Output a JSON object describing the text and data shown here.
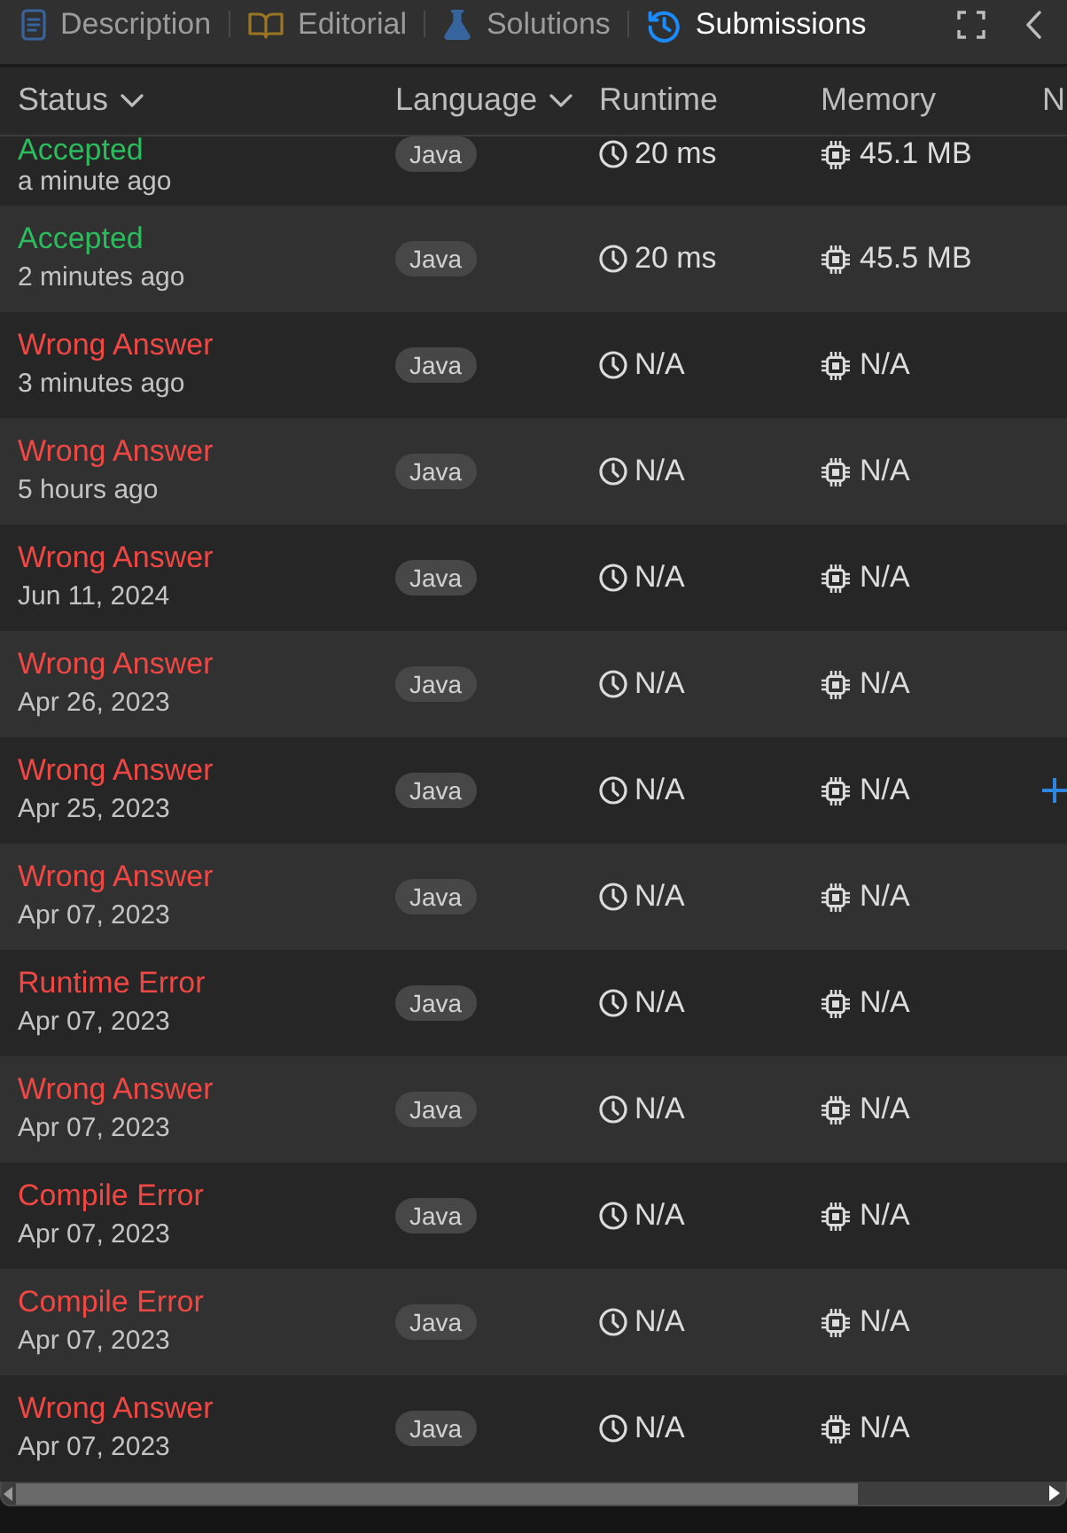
{
  "tabs": [
    {
      "label": "Description",
      "selected": false
    },
    {
      "label": "Editorial",
      "selected": false
    },
    {
      "label": "Solutions",
      "selected": false
    },
    {
      "label": "Submissions",
      "selected": true
    }
  ],
  "columns": [
    {
      "label": "Status",
      "dropdown": true
    },
    {
      "label": "Language",
      "dropdown": true
    },
    {
      "label": "Runtime",
      "dropdown": false
    },
    {
      "label": "Memory",
      "dropdown": false
    },
    {
      "label": "N",
      "dropdown": false
    }
  ],
  "rows": [
    {
      "status": "Accepted",
      "color": "#2cbb5d",
      "time": "a minute ago",
      "language": "Java",
      "runtime": "20 ms",
      "memory": "45.1 MB",
      "note_button": false
    },
    {
      "status": "Accepted",
      "color": "#2cbb5d",
      "time": "2 minutes ago",
      "language": "Java",
      "runtime": "20 ms",
      "memory": "45.5 MB",
      "note_button": false
    },
    {
      "status": "Wrong Answer",
      "color": "#ef4743",
      "time": "3 minutes ago",
      "language": "Java",
      "runtime": "N/A",
      "memory": "N/A",
      "note_button": false
    },
    {
      "status": "Wrong Answer",
      "color": "#ef4743",
      "time": "5 hours ago",
      "language": "Java",
      "runtime": "N/A",
      "memory": "N/A",
      "note_button": false
    },
    {
      "status": "Wrong Answer",
      "color": "#ef4743",
      "time": "Jun 11, 2024",
      "language": "Java",
      "runtime": "N/A",
      "memory": "N/A",
      "note_button": false
    },
    {
      "status": "Wrong Answer",
      "color": "#ef4743",
      "time": "Apr 26, 2023",
      "language": "Java",
      "runtime": "N/A",
      "memory": "N/A",
      "note_button": false
    },
    {
      "status": "Wrong Answer",
      "color": "#ef4743",
      "time": "Apr 25, 2023",
      "language": "Java",
      "runtime": "N/A",
      "memory": "N/A",
      "note_button": true
    },
    {
      "status": "Wrong Answer",
      "color": "#ef4743",
      "time": "Apr 07, 2023",
      "language": "Java",
      "runtime": "N/A",
      "memory": "N/A",
      "note_button": false
    },
    {
      "status": "Runtime Error",
      "color": "#ef4743",
      "time": "Apr 07, 2023",
      "language": "Java",
      "runtime": "N/A",
      "memory": "N/A",
      "note_button": false
    },
    {
      "status": "Wrong Answer",
      "color": "#ef4743",
      "time": "Apr 07, 2023",
      "language": "Java",
      "runtime": "N/A",
      "memory": "N/A",
      "note_button": false
    },
    {
      "status": "Compile Error",
      "color": "#ef4743",
      "time": "Apr 07, 2023",
      "language": "Java",
      "runtime": "N/A",
      "memory": "N/A",
      "note_button": false
    },
    {
      "status": "Compile Error",
      "color": "#ef4743",
      "time": "Apr 07, 2023",
      "language": "Java",
      "runtime": "N/A",
      "memory": "N/A",
      "note_button": false
    },
    {
      "status": "Wrong Answer",
      "color": "#ef4743",
      "time": "Apr 07, 2023",
      "language": "Java",
      "runtime": "N/A",
      "memory": "N/A",
      "note_button": false
    }
  ]
}
